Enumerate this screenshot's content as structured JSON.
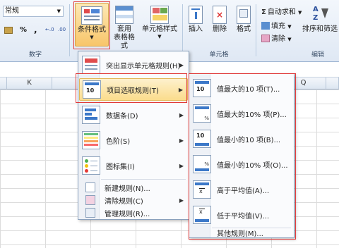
{
  "ribbon": {
    "number_format": "常规",
    "percent_symbol": "%",
    "comma_symbol": ",",
    "number_group_label": "数字",
    "cond_format_label": "条件格式",
    "table_format_line1": "套用",
    "table_format_line2": "表格格式",
    "cell_style_label": "单元格样式",
    "insert_label": "插入",
    "delete_label": "删除",
    "format_label": "格式",
    "cells_group_label": "单元格",
    "autosum_label": "自动求和",
    "fill_label": "填充",
    "clear_label": "清除",
    "sort_filter_label": "排序和筛选",
    "edit_group_label": "编辑"
  },
  "grid": {
    "col_k": "K",
    "col_q": "Q"
  },
  "menu": {
    "highlight_rules": "突出显示单元格规则(H)",
    "top_bottom_rules": "项目选取规则(T)",
    "data_bars": "数据条(D)",
    "color_scales": "色阶(S)",
    "icon_sets": "图标集(I)",
    "new_rule": "新建规则(N)...",
    "clear_rules": "清除规则(C)",
    "manage_rules": "管理规则(R)..."
  },
  "submenu": {
    "top10": "值最大的10 项(T)...",
    "top10pct": "值最大的10% 项(P)...",
    "bottom10": "值最小的10 项(B)...",
    "bottom10pct": "值最小的10% 项(O)...",
    "above_avg": "高于平均值(A)...",
    "below_avg": "低于平均值(V)...",
    "more_rules": "其他规则(M)..."
  },
  "icons": {
    "ten": "10",
    "percent": "%",
    "sigma": "Σ"
  },
  "colors": {
    "highlight_border": "#e03a3a",
    "menu_hover": "#fbdc8c"
  }
}
